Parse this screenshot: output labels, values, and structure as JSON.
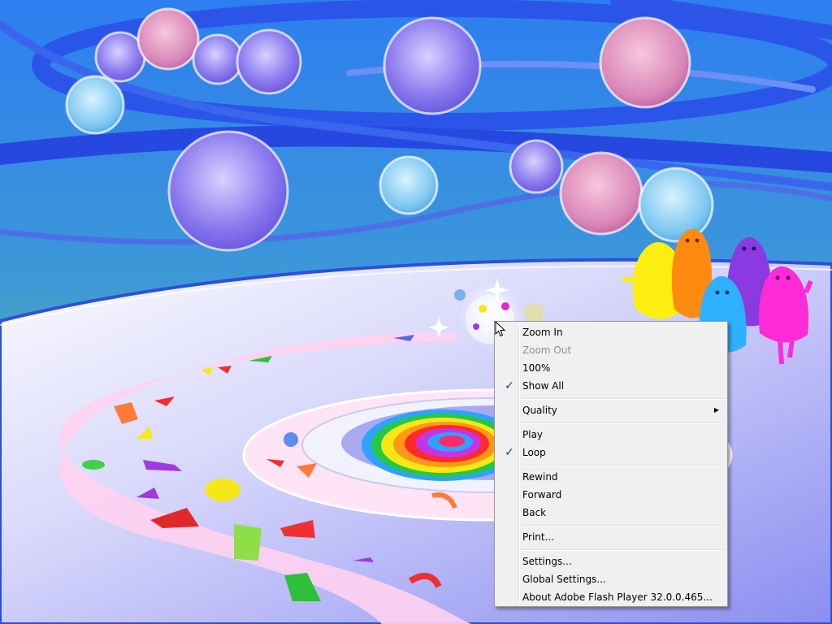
{
  "scene": {
    "description_colors": {
      "sky_top": "#2c7ce6",
      "sky_bottom": "#9ecb3a",
      "floor": "#b9b9f5",
      "path": "#ffd6f2",
      "ring": "#3a5fe0"
    }
  },
  "context_menu": {
    "items": [
      {
        "label": "Zoom In",
        "enabled": true,
        "checked": false
      },
      {
        "label": "Zoom Out",
        "enabled": false,
        "checked": false
      },
      {
        "label": "100%",
        "enabled": true,
        "checked": false
      },
      {
        "label": "Show All",
        "enabled": true,
        "checked": true
      },
      {
        "label": "Quality",
        "enabled": true,
        "checked": false,
        "submenu": true
      },
      {
        "label": "Play",
        "enabled": true,
        "checked": false
      },
      {
        "label": "Loop",
        "enabled": true,
        "checked": true
      },
      {
        "label": "Rewind",
        "enabled": true,
        "checked": false
      },
      {
        "label": "Forward",
        "enabled": true,
        "checked": false
      },
      {
        "label": "Back",
        "enabled": true,
        "checked": false
      },
      {
        "label": "Print...",
        "enabled": true,
        "checked": false
      },
      {
        "label": "Settings...",
        "enabled": true,
        "checked": false
      },
      {
        "label": "Global Settings...",
        "enabled": true,
        "checked": false
      },
      {
        "label": "About Adobe Flash Player 32.0.0.465...",
        "enabled": true,
        "checked": false
      }
    ],
    "check_glyph": "✓",
    "submenu_glyph": "▶"
  },
  "icons": {
    "cursor": "arrow-cursor-icon",
    "check": "checkmark-icon",
    "submenu": "submenu-arrow-icon"
  }
}
